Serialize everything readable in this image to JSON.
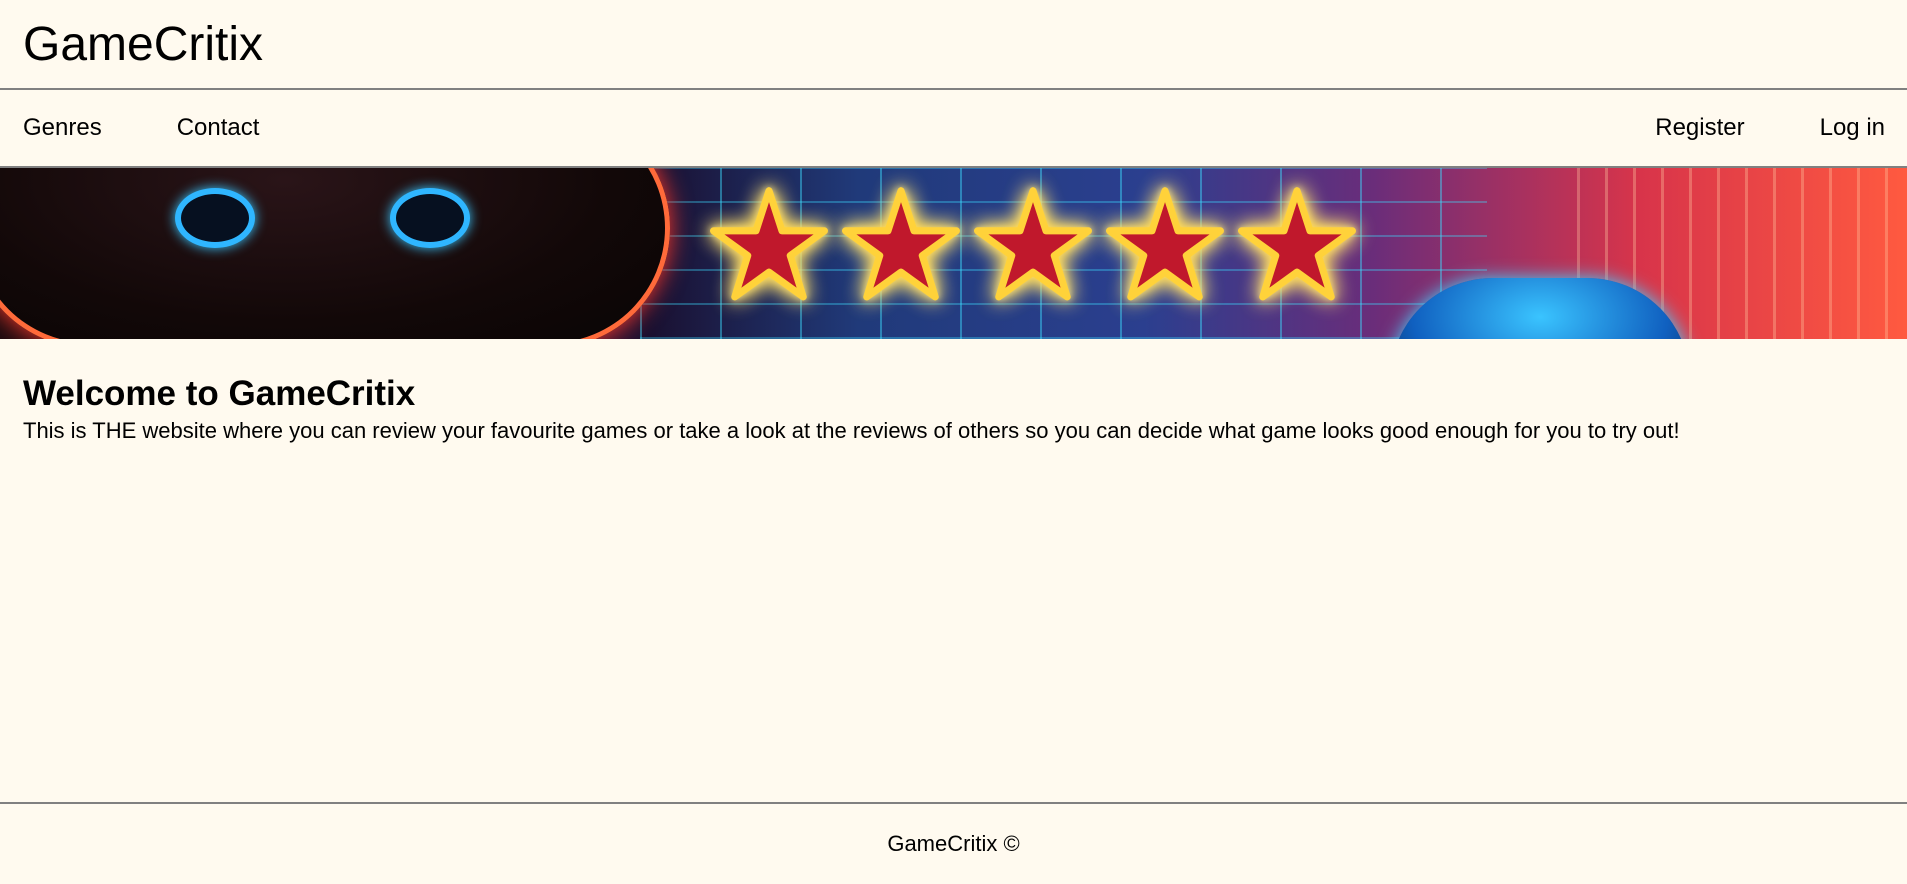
{
  "header": {
    "title": "GameCritix"
  },
  "nav": {
    "left": [
      {
        "label": "Genres"
      },
      {
        "label": "Contact"
      }
    ],
    "right": [
      {
        "label": "Register"
      },
      {
        "label": "Log in"
      }
    ]
  },
  "banner": {
    "star_count": 5,
    "star_color": "#c0182c",
    "glow_color": "#ffd23a"
  },
  "main": {
    "title": "Welcome to GameCritix",
    "text": "This is THE website where you can review your favourite games or take a look at the reviews of others so you can decide what game looks good enough for you to try out!"
  },
  "footer": {
    "text": "GameCritix ©"
  }
}
